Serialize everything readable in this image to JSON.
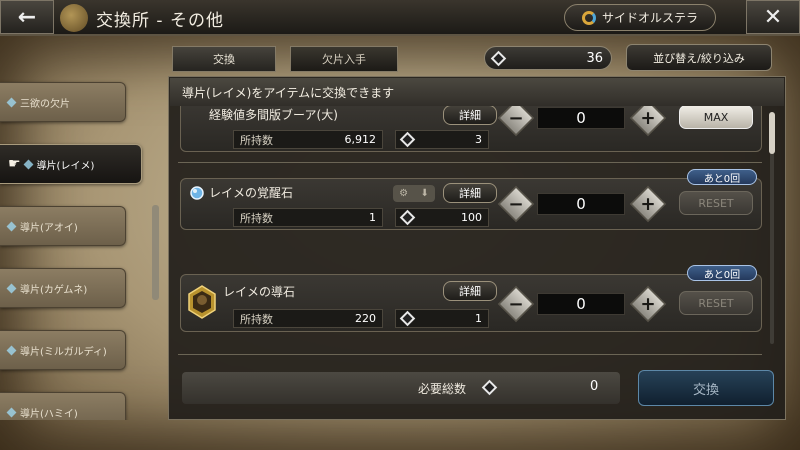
{
  "header": {
    "back_glyph": "←",
    "title": "交換所 - その他",
    "side_button": "サイドオルステラ",
    "close_glyph": "✕"
  },
  "left_list": {
    "items": [
      {
        "label": "三欲の欠片",
        "active": false
      },
      {
        "label": "導片(レイメ)",
        "active": true
      },
      {
        "label": "導片(アオイ)",
        "active": false
      },
      {
        "label": "導片(カゲムネ)",
        "active": false
      },
      {
        "label": "導片(ミルガルディ)",
        "active": false
      },
      {
        "label": "導片(ハミイ)",
        "active": false
      }
    ]
  },
  "tabs": [
    {
      "label": "交換"
    },
    {
      "label": "欠片入手"
    }
  ],
  "currency": {
    "value": "36"
  },
  "sort_button": "並び替え/絞り込み",
  "info_text": "導片(レイメ)をアイテムに交換できます",
  "rows": [
    {
      "name": "経験値多間版ブーア(大)",
      "detail": "詳細",
      "owned_label": "所持数",
      "owned": "6,912",
      "cost": "3",
      "qty": "0",
      "action": "MAX",
      "remaining": ""
    },
    {
      "name": "レイメの覚醒石",
      "detail": "詳細",
      "owned_label": "所持数",
      "owned": "1",
      "cost": "100",
      "qty": "0",
      "action": "RESET",
      "remaining": "あと0回"
    },
    {
      "name": "レイメの導石",
      "detail": "詳細",
      "owned_label": "所持数",
      "owned": "220",
      "cost": "1",
      "qty": "0",
      "action": "RESET",
      "remaining": "あと0回"
    }
  ],
  "stepper": {
    "minus": "−",
    "plus": "+"
  },
  "footer": {
    "required_label": "必要総数",
    "required_value": "0",
    "exchange_button": "交換"
  },
  "colors": {
    "accent_blue": "#274157",
    "badge_blue": "#3f5f8a",
    "panel_dark": "#221f1b"
  }
}
